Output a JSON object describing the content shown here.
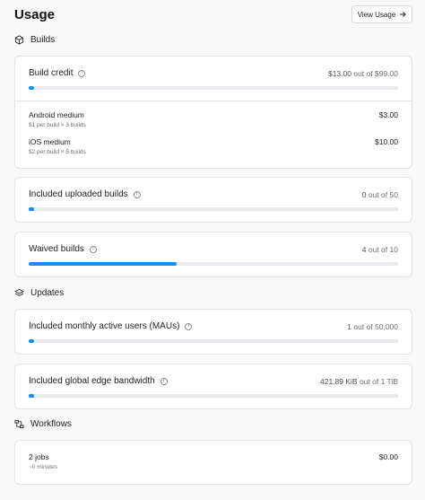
{
  "page": {
    "title": "Usage",
    "view_usage_label": "View Usage"
  },
  "sections": {
    "builds": "Builds",
    "updates": "Updates",
    "workflows": "Workflows"
  },
  "build_credit": {
    "label": "Build credit",
    "used": "$13.00",
    "sep": "out of",
    "total": "$99.00",
    "progress_fraction": 0.013,
    "items": [
      {
        "name": "Android medium",
        "sub": "$1 per build × 3 builds",
        "price": "$3.00"
      },
      {
        "name": "iOS medium",
        "sub": "$2 per build × 5 builds",
        "price": "$10.00"
      }
    ]
  },
  "uploaded_builds": {
    "label": "Included uploaded builds",
    "used": "0",
    "sep": "out of",
    "total": "50",
    "progress_fraction": 0.0
  },
  "waived_builds": {
    "label": "Waived builds",
    "used": "4",
    "sep": "out of",
    "total": "10",
    "progress_fraction": 0.4
  },
  "maus": {
    "label": "Included monthly active users (MAUs)",
    "used": "1",
    "sep": "out of",
    "total": "50,000",
    "progress_fraction": 0.0
  },
  "bandwidth": {
    "label": "Included global edge bandwidth",
    "used": "421.89 KiB",
    "sep": "out of",
    "total": "1 TiB",
    "progress_fraction": 0.0
  },
  "workflows": {
    "jobs": "2 jobs",
    "duration": "~0 minutes",
    "price": "$0.00"
  },
  "colors": {
    "accent": "#1a8cf0",
    "track": "#e8e9ec"
  }
}
